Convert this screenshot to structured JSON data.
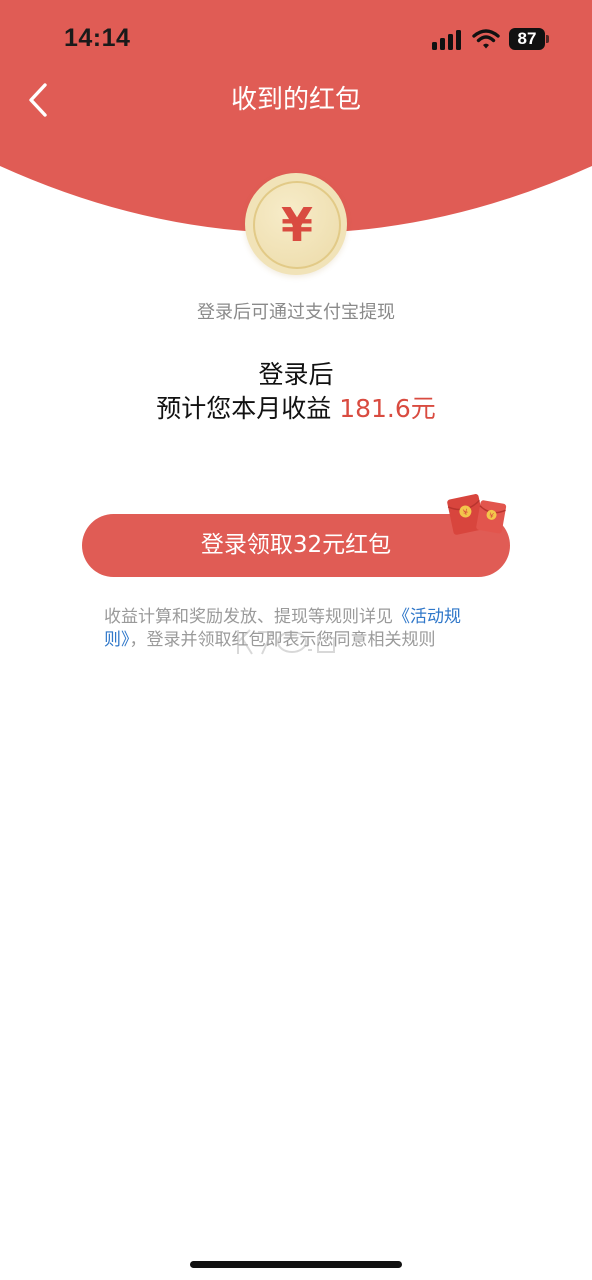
{
  "status_bar": {
    "time": "14:14",
    "battery": "87"
  },
  "header": {
    "title": "收到的红包"
  },
  "coin": {
    "symbol": "¥"
  },
  "main": {
    "login_hint": "登录后可通过支付宝提现",
    "estimate_line1": "登录后",
    "estimate_prefix": "预计您本月收益 ",
    "estimate_amount": "181.6元"
  },
  "claim_button": {
    "label": "登录领取32元红包"
  },
  "rules": {
    "text_before": "收益计算和奖励发放、提现等规则详见",
    "link_text": "《活动规则》",
    "text_after": "，登录并领取红包即表示您同意相关规则"
  },
  "colors": {
    "header_red": "#e05c55",
    "accent_red": "#d94b40",
    "coin_gold": "#f1e3b8",
    "link_blue": "#2f77c9"
  }
}
